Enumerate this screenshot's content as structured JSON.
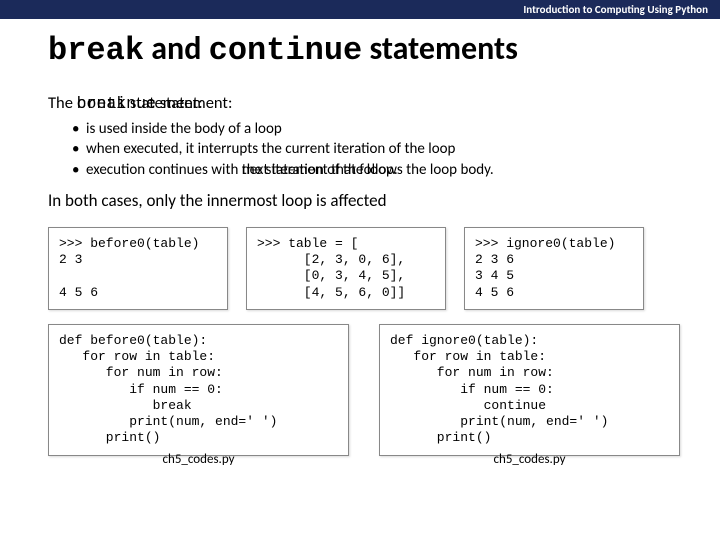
{
  "topbar": {
    "text": "Introduction to Computing Using Python"
  },
  "title": {
    "word1": "break",
    "middle": " and ",
    "word2": "continue",
    "rest": " statements"
  },
  "lead": {
    "prefix": "The ",
    "base_mono": "break",
    "overlay_mono": "continue",
    "base_tail": " statement:",
    "overlay_tail": " statement:"
  },
  "bullets": {
    "b1": "is used inside the body of a loop",
    "b2": "when executed, it interrupts the current iteration of the loop",
    "b3_prefix": "execution continues with ",
    "b3_base": "the statement that follows the loop body.",
    "b3_overlay": "next iteration of the loop."
  },
  "summary": "In both cases, only the innermost loop is affected",
  "codeboxes": {
    "top_left": ">>> before0(table)\n2 3\n\n4 5 6",
    "top_mid": ">>> table = [\n      [2, 3, 0, 6],\n      [0, 3, 4, 5],\n      [4, 5, 6, 0]]",
    "top_right": ">>> ignore0(table)\n2 3 6\n3 4 5\n4 5 6",
    "bot_left": "def before0(table):\n   for row in table:\n      for num in row:\n         if num == 0:\n            break\n         print(num, end=' ')\n      print()",
    "bot_right": "def ignore0(table):\n   for row in table:\n      for num in row:\n         if num == 0:\n            continue\n         print(num, end=' ')\n      print()"
  },
  "filename": "ch5_codes.py"
}
